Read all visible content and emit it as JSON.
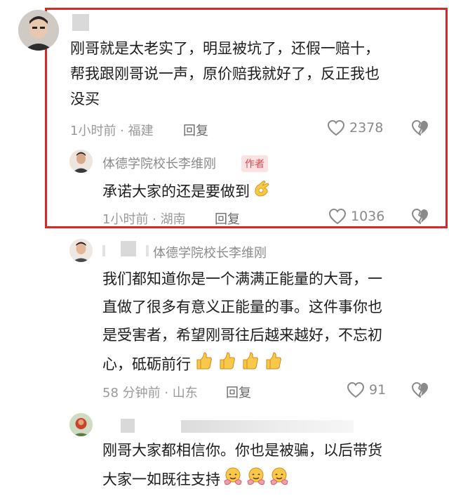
{
  "comments": [
    {
      "lines": [
        "刚哥就是太老实了，明显被坑了，还假一赔十，",
        "帮我跟刚哥说一声，原价赔我就好了，反正我也",
        "没买"
      ],
      "time_location": "1小时前 · 福建",
      "reply_label": "回复",
      "likes": "2378"
    },
    {
      "author": "体德学院校长李维刚",
      "author_badge": "作者",
      "lines": [
        "承诺大家的还是要做到"
      ],
      "time_location": "1小时前 · 湖南",
      "reply_label": "回复",
      "likes": "1036"
    },
    {
      "reply_to": "体德学院校长李维刚",
      "lines": [
        "我们都知道你是一个满满正能量的大哥，一",
        "直做了很多有意义正能量的事。这件事你也",
        "是受害者，希望刚哥往后越来越好，不忘初",
        "心，砥砺前行"
      ],
      "time_location": "58 分钟前 · 山东",
      "reply_label": "回复",
      "likes": "91"
    },
    {
      "lines": [
        "刚哥大家都相信你。你也是被骗，以后带货",
        "大家一如既往支持"
      ]
    }
  ],
  "colors": {
    "highlight_border": "#d4282a",
    "badge_text": "#e0464b",
    "badge_bg": "#fbe3e3"
  },
  "icons": [
    "ok-hand-emoji",
    "thumbs-up-emoji",
    "hugging-face-emoji",
    "heart-outline-icon",
    "broken-heart-icon"
  ]
}
